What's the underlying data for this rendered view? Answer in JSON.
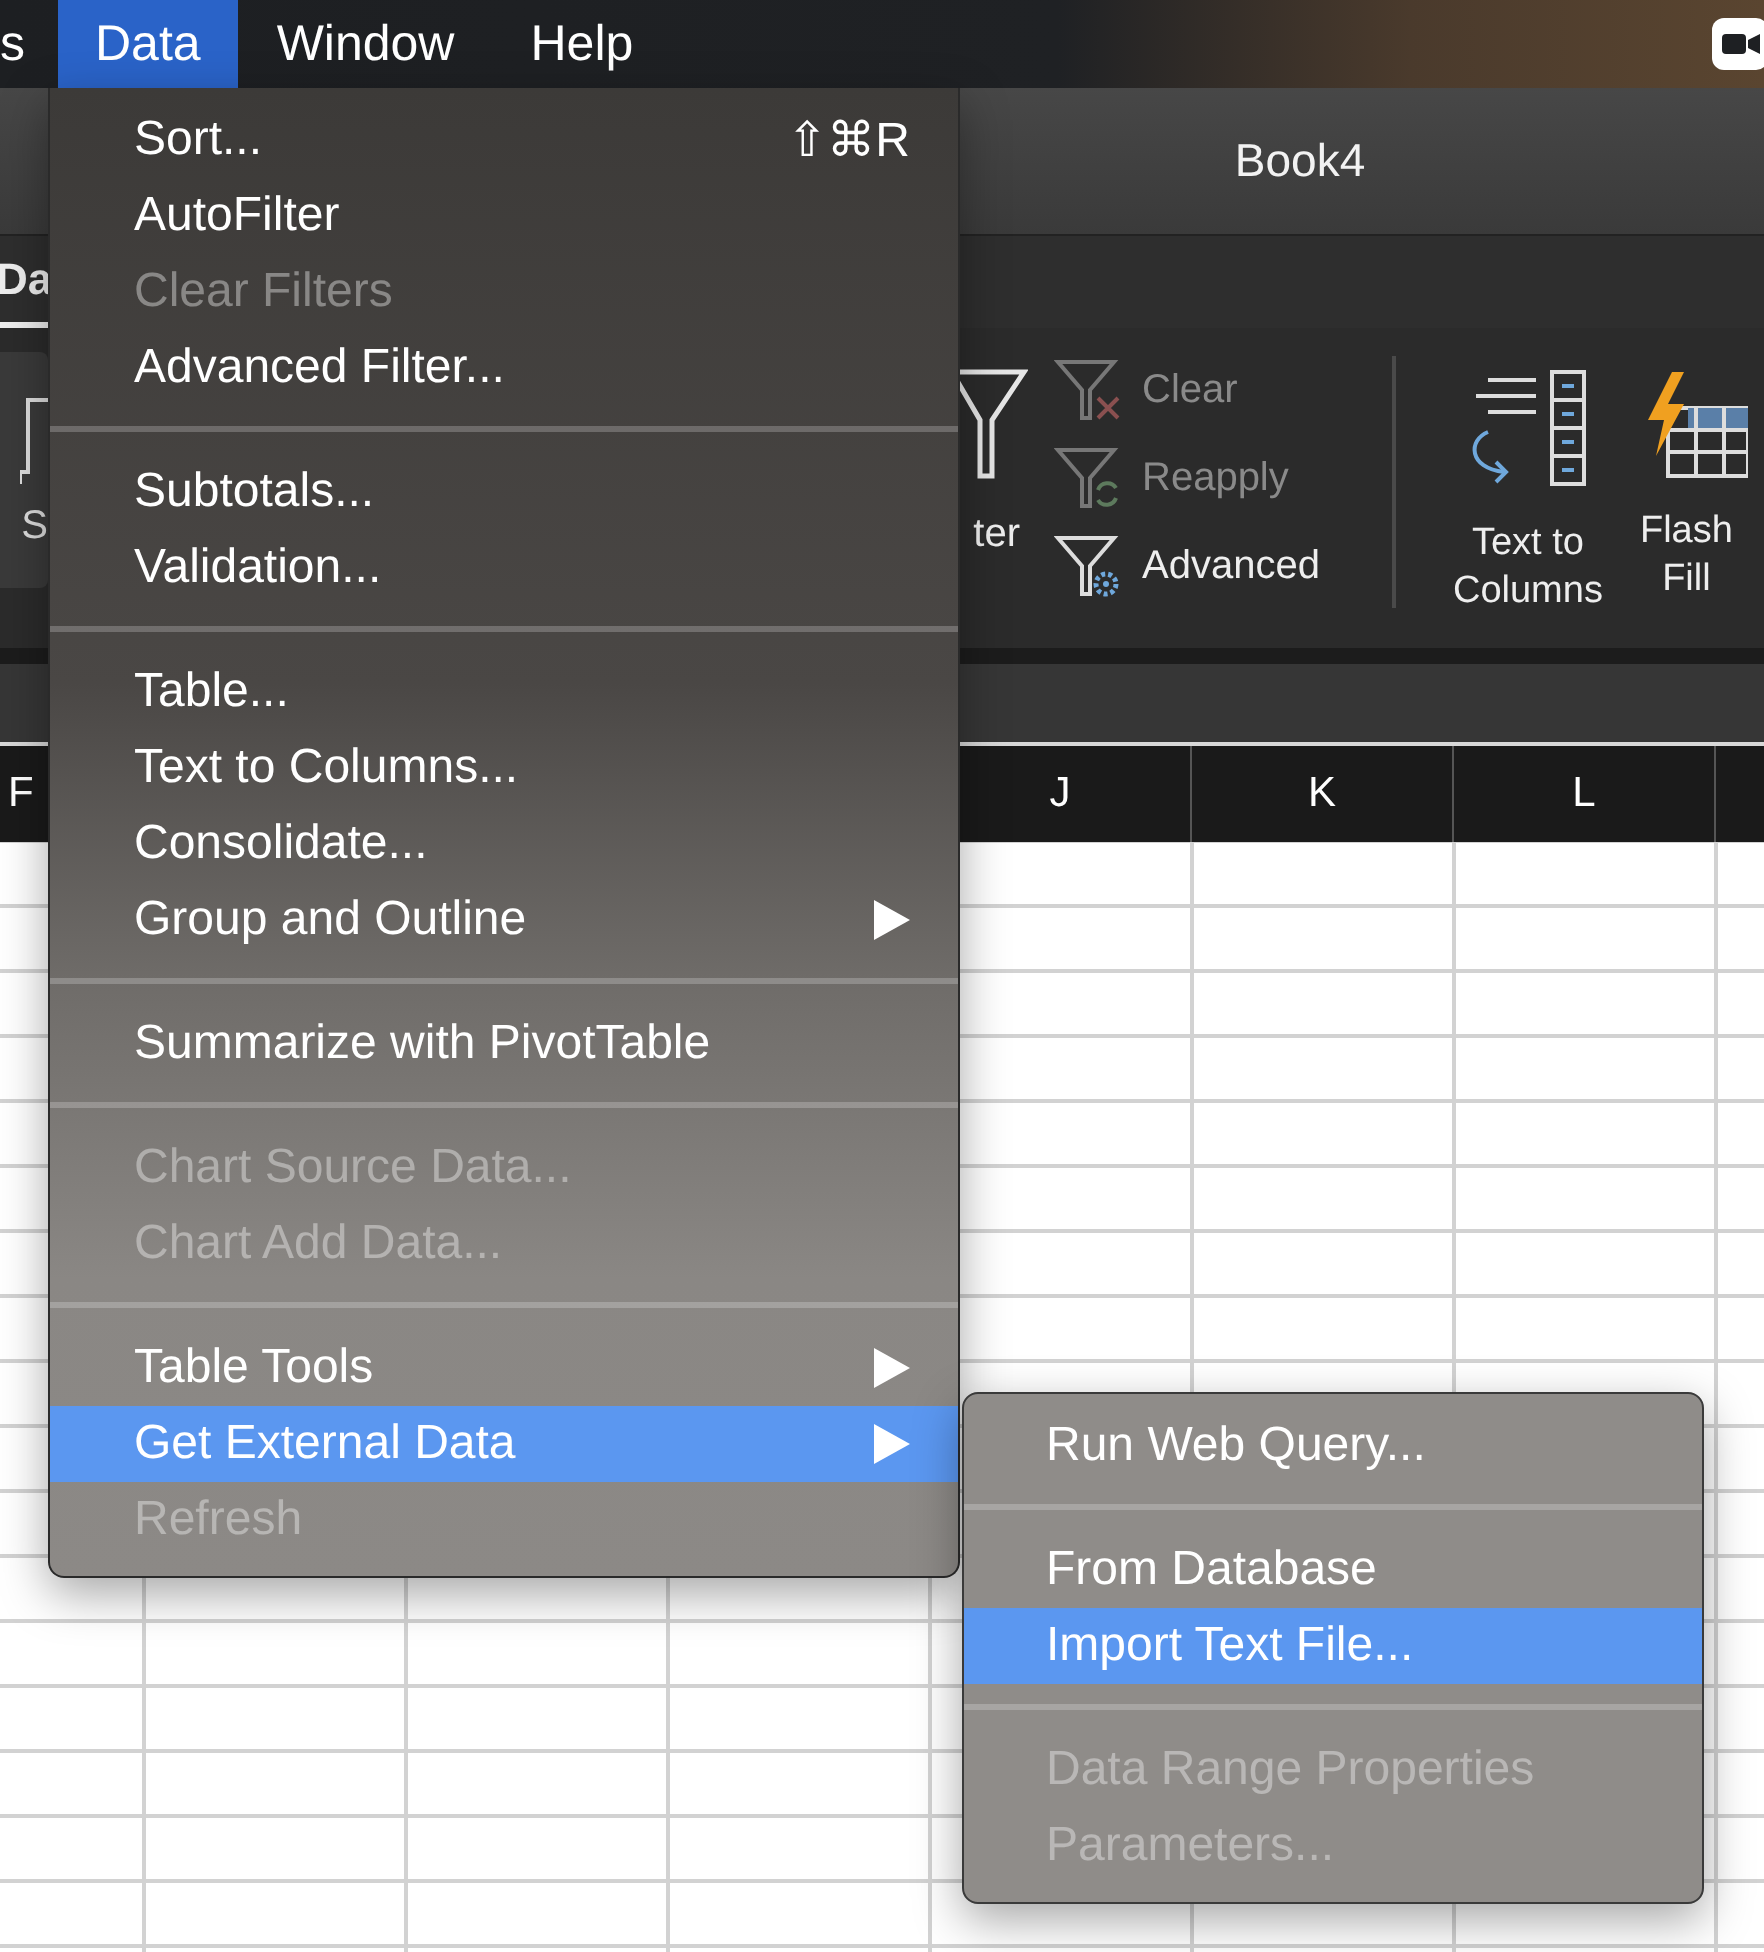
{
  "menu_bar": {
    "items": [
      {
        "label": "s",
        "selected": false
      },
      {
        "label": "Data",
        "selected": true
      },
      {
        "label": "Window",
        "selected": false
      },
      {
        "label": "Help",
        "selected": false
      }
    ]
  },
  "window": {
    "title": "Book4"
  },
  "ribbon": {
    "tab": {
      "label": "Da",
      "selected": true
    },
    "left_button": {
      "label": "S"
    },
    "filter_button": {
      "label": "ter"
    },
    "small_buttons": [
      {
        "kind": "clear",
        "label": "Clear",
        "disabled": true
      },
      {
        "kind": "reapply",
        "label": "Reapply",
        "disabled": true
      },
      {
        "kind": "advanced",
        "label": "Advanced",
        "disabled": false
      }
    ],
    "large_buttons": [
      {
        "kind": "text-to-columns",
        "lines": [
          "Text to",
          "Columns"
        ]
      },
      {
        "kind": "flash-fill",
        "lines": [
          "Flash",
          "Fill"
        ]
      }
    ]
  },
  "sheet": {
    "column_headers": [
      "F",
      "J",
      "K",
      "L"
    ]
  },
  "data_menu": {
    "items": [
      {
        "kind": "item",
        "label": "Sort...",
        "shortcut": "⇧⌘R",
        "disabled": false,
        "selected": false,
        "submenu": false
      },
      {
        "kind": "item",
        "label": "AutoFilter",
        "disabled": false,
        "selected": false,
        "submenu": false
      },
      {
        "kind": "item",
        "label": "Clear Filters",
        "disabled": true,
        "selected": false,
        "submenu": false
      },
      {
        "kind": "item",
        "label": "Advanced Filter...",
        "disabled": false,
        "selected": false,
        "submenu": false
      },
      {
        "kind": "separator"
      },
      {
        "kind": "item",
        "label": "Subtotals...",
        "disabled": false,
        "selected": false,
        "submenu": false
      },
      {
        "kind": "item",
        "label": "Validation...",
        "disabled": false,
        "selected": false,
        "submenu": false
      },
      {
        "kind": "separator"
      },
      {
        "kind": "item",
        "label": "Table...",
        "disabled": false,
        "selected": false,
        "submenu": false
      },
      {
        "kind": "item",
        "label": "Text to Columns...",
        "disabled": false,
        "selected": false,
        "submenu": false
      },
      {
        "kind": "item",
        "label": "Consolidate...",
        "disabled": false,
        "selected": false,
        "submenu": false
      },
      {
        "kind": "item",
        "label": "Group and Outline",
        "disabled": false,
        "selected": false,
        "submenu": true
      },
      {
        "kind": "separator"
      },
      {
        "kind": "item",
        "label": "Summarize with PivotTable",
        "disabled": false,
        "selected": false,
        "submenu": false
      },
      {
        "kind": "separator"
      },
      {
        "kind": "item",
        "label": "Chart Source Data...",
        "disabled": true,
        "selected": false,
        "submenu": false
      },
      {
        "kind": "item",
        "label": "Chart Add Data...",
        "disabled": true,
        "selected": false,
        "submenu": false
      },
      {
        "kind": "separator"
      },
      {
        "kind": "item",
        "label": "Table Tools",
        "disabled": false,
        "selected": false,
        "submenu": true
      },
      {
        "kind": "item",
        "label": "Get External Data",
        "disabled": false,
        "selected": true,
        "submenu": true
      },
      {
        "kind": "item",
        "label": "Refresh",
        "disabled": true,
        "selected": false,
        "submenu": false
      }
    ]
  },
  "external_data_submenu": {
    "items": [
      {
        "kind": "item",
        "label": "Run Web Query...",
        "disabled": false,
        "selected": false,
        "submenu": false
      },
      {
        "kind": "separator"
      },
      {
        "kind": "item",
        "label": "From Database",
        "disabled": false,
        "selected": false,
        "submenu": false
      },
      {
        "kind": "item",
        "label": "Import Text File...",
        "disabled": false,
        "selected": true,
        "submenu": false
      },
      {
        "kind": "separator"
      },
      {
        "kind": "item",
        "label": "Data Range Properties",
        "disabled": true,
        "selected": false,
        "submenu": false
      },
      {
        "kind": "item",
        "label": "Parameters...",
        "disabled": true,
        "selected": false,
        "submenu": false
      }
    ]
  }
}
